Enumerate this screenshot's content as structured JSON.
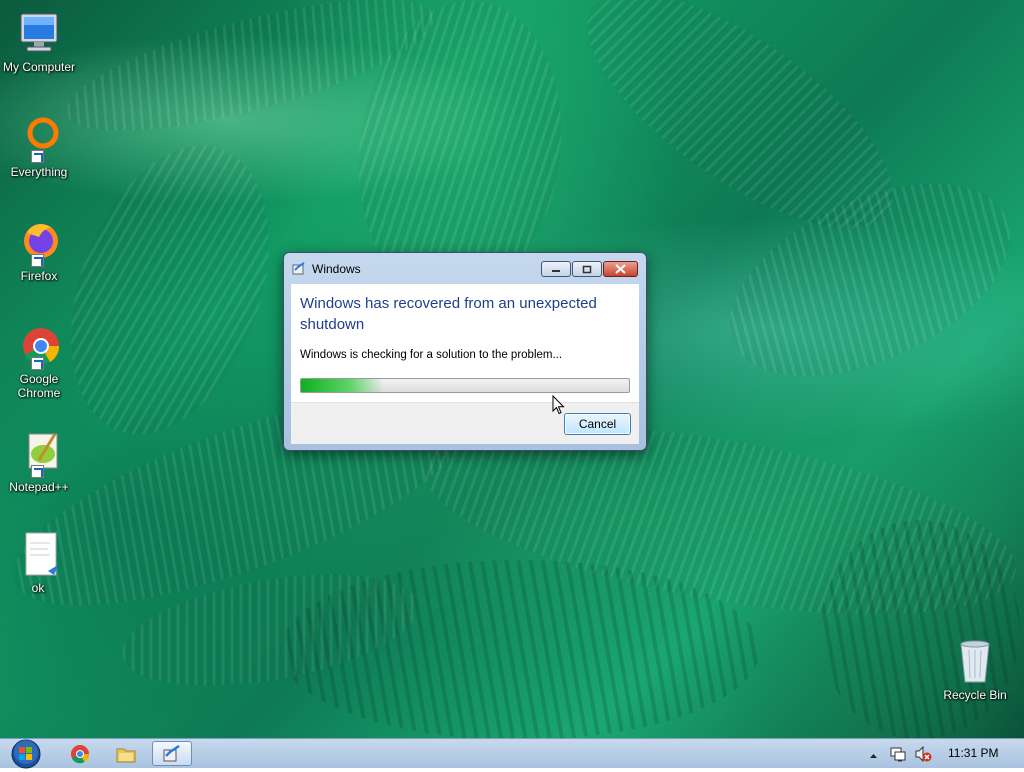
{
  "desktop": {
    "icons": [
      {
        "label": "My Computer",
        "icon": "computer-icon"
      },
      {
        "label": "Everything",
        "icon": "everything-icon"
      },
      {
        "label": "Firefox",
        "icon": "firefox-icon"
      },
      {
        "label": "Google Chrome",
        "icon": "chrome-icon"
      },
      {
        "label": "Notepad++",
        "icon": "notepadpp-icon"
      },
      {
        "label": "ok",
        "icon": "document-icon"
      },
      {
        "label": "Recycle Bin",
        "icon": "recycle-bin-icon"
      }
    ]
  },
  "dialog": {
    "title": "Windows",
    "heading": "Windows has recovered from an unexpected shutdown",
    "message": "Windows is checking for a solution to the problem...",
    "progress_fraction": 0.25,
    "cancel_label": "Cancel"
  },
  "taskbar": {
    "pinned": [
      "start-orb-icon",
      "chrome-icon",
      "explorer-icon",
      "problem-reports-icon"
    ],
    "clock": "11:31 PM",
    "tray": [
      "show-hidden-icon",
      "network-icon",
      "volume-muted-icon"
    ]
  },
  "colors": {
    "heading": "#1e3f8c",
    "progress": "#0fb020",
    "close_button": "#c8452e"
  }
}
